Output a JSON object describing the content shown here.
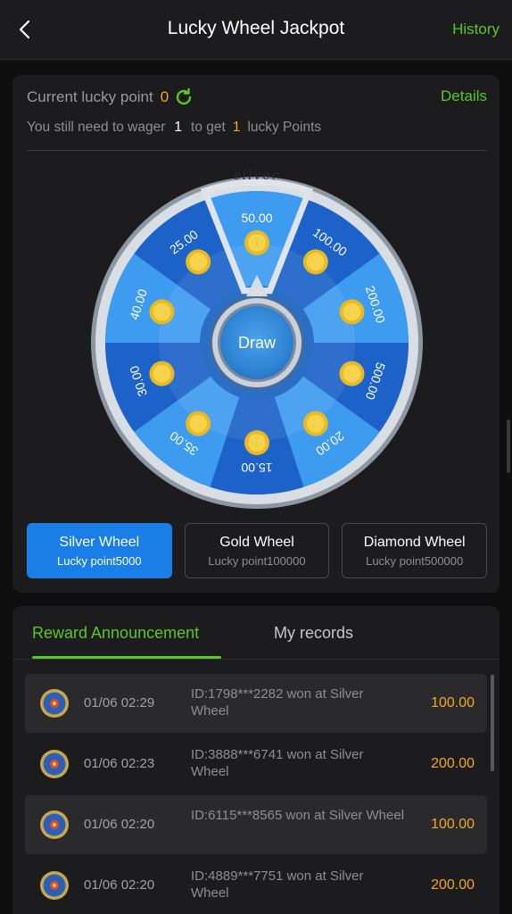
{
  "colors": {
    "accent_green": "#5ac81f",
    "accent_orange": "#f5a623",
    "accent_blue": "#1a7ee8",
    "wheel_blue_light": "#3e9cf0",
    "wheel_blue_dark": "#1d62c9"
  },
  "header": {
    "title": "Lucky Wheel Jackpot",
    "history_label": "History",
    "back_icon": "chevron-left-icon"
  },
  "lucky": {
    "label": "Current lucky point",
    "value": "0",
    "refresh_icon": "refresh-icon",
    "details_label": "Details",
    "wager_prefix": "You still need to wager",
    "wager_amount": "1",
    "wager_middle": "to get",
    "wager_points": "1",
    "wager_suffix": "lucky Points"
  },
  "wheel": {
    "tag": "silver",
    "draw_label": "Draw",
    "segments": [
      "50.00",
      "100.00",
      "200.00",
      "500.00",
      "20.00",
      "15.00",
      "35.00",
      "30.00",
      "40.00",
      "25.00"
    ]
  },
  "wheel_tabs": [
    {
      "name": "Silver Wheel",
      "sub": "Lucky point5000",
      "active": true
    },
    {
      "name": "Gold Wheel",
      "sub": "Lucky point100000",
      "active": false
    },
    {
      "name": "Diamond Wheel",
      "sub": "Lucky point500000",
      "active": false
    }
  ],
  "announcement": {
    "tab_reward": "Reward Announcement",
    "tab_records": "My records",
    "records": [
      {
        "time": "01/06 02:29",
        "text": "ID:1798***2282 won at Silver Wheel",
        "amount": "100.00"
      },
      {
        "time": "01/06 02:23",
        "text": "ID:3888***6741 won at Silver Wheel",
        "amount": "200.00"
      },
      {
        "time": "01/06 02:20",
        "text": "ID:6115***8565 won at Silver Wheel",
        "amount": "100.00"
      },
      {
        "time": "01/06 02:20",
        "text": "ID:4889***7751 won at Silver Wheel",
        "amount": "200.00"
      }
    ]
  }
}
